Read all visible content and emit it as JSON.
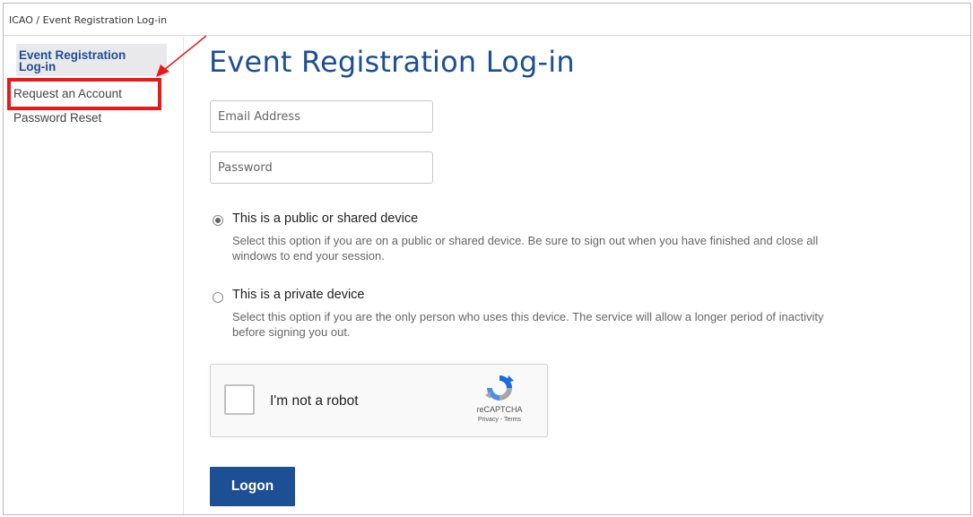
{
  "breadcrumb": "ICAO / Event Registration Log-in",
  "sidebar": {
    "items": [
      {
        "label_line1": "Event Registration",
        "label_line2": "Log-in",
        "active": true
      },
      {
        "label": "Request an Account"
      },
      {
        "label": "Password Reset"
      }
    ]
  },
  "annotation": {
    "highlight_color": "#e8191b"
  },
  "main": {
    "title": "Event Registration Log-in",
    "email": {
      "value": "",
      "placeholder": "Email Address"
    },
    "password": {
      "value": "",
      "placeholder": "Password"
    },
    "options": [
      {
        "title": "This is a public or shared device",
        "desc_line1": "Select this option if you are on a public or shared device. Be sure to sign out when you have finished and close all",
        "desc_line2": "windows to end your session.",
        "selected": true
      },
      {
        "title": "This is a private device",
        "desc_line1": "Select this option if you are the only person who uses this device. The service will allow a longer period of inactivity",
        "desc_line2": "before signing you out.",
        "selected": false
      }
    ],
    "recaptcha": {
      "label": "I'm not a robot",
      "brand": "reCAPTCHA",
      "links": "Privacy - Terms",
      "icon": "recaptcha-logo-icon"
    },
    "logon_label": "Logon"
  },
  "colors": {
    "accent": "#1c4f93",
    "annotation": "#e8191b"
  }
}
